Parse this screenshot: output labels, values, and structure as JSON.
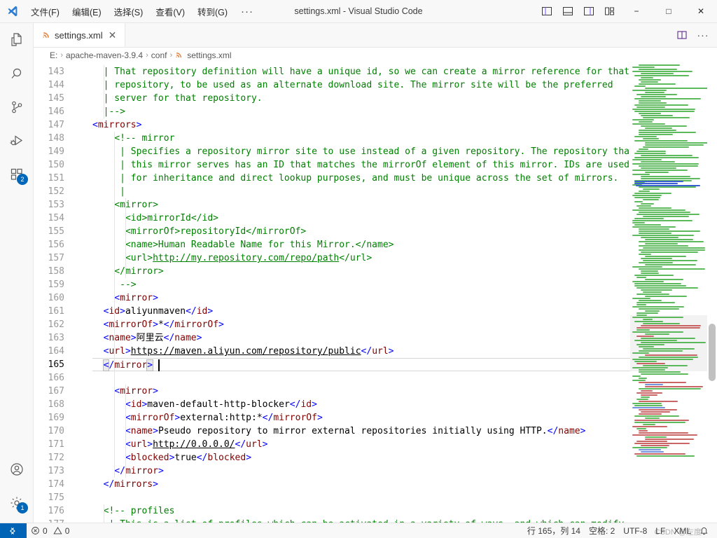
{
  "window": {
    "title": "settings.xml - Visual Studio Code",
    "logo_icon": "vscode-logo"
  },
  "menubar": {
    "items": [
      {
        "label": "文件(F)",
        "name": "menu-file"
      },
      {
        "label": "编辑(E)",
        "name": "menu-edit"
      },
      {
        "label": "选择(S)",
        "name": "menu-selection"
      },
      {
        "label": "查看(V)",
        "name": "menu-view"
      },
      {
        "label": "转到(G)",
        "name": "menu-go"
      }
    ],
    "more_label": "···"
  },
  "titlebar_controls": {
    "toggle_primary_sidebar": "layout-sidebar-left-icon",
    "toggle_panel": "layout-panel-icon",
    "toggle_secondary_sidebar": "layout-sidebar-right-icon",
    "customize_layout": "layout-customize-icon",
    "minimize": "−",
    "maximize": "□",
    "close": "✕"
  },
  "activitybar": {
    "items": [
      {
        "name": "activitybar-explorer",
        "icon": "files-icon",
        "active": false,
        "badge": ""
      },
      {
        "name": "activitybar-search",
        "icon": "search-icon",
        "active": false,
        "badge": ""
      },
      {
        "name": "activitybar-source-control",
        "icon": "source-control-icon",
        "active": false,
        "badge": ""
      },
      {
        "name": "activitybar-run-debug",
        "icon": "run-and-debug-icon",
        "active": false,
        "badge": ""
      },
      {
        "name": "activitybar-extensions",
        "icon": "extensions-icon",
        "active": false,
        "badge": "2"
      }
    ],
    "bottom_items": [
      {
        "name": "activitybar-accounts",
        "icon": "account-icon",
        "badge": ""
      },
      {
        "name": "activitybar-manage",
        "icon": "gear-icon",
        "badge": "1"
      }
    ]
  },
  "tabs": [
    {
      "label": "settings.xml",
      "icon": "xml-file-icon",
      "close": "✕",
      "active": true
    }
  ],
  "editor_actions": {
    "split_editor": "split-editor-icon",
    "more_actions": "···"
  },
  "breadcrumb": {
    "items": [
      "E:",
      "apache-maven-3.9.4",
      "conf",
      "settings.xml"
    ],
    "separator": "›",
    "file_icon": "xml-file-icon"
  },
  "editor": {
    "first_line": 143,
    "lines": [
      {
        "n": 143,
        "fold": "",
        "indent": 0,
        "tokens": [
          {
            "t": "cmt",
            "v": "  | That repository definition will have a unique id, so we can create a mirror reference for that"
          }
        ]
      },
      {
        "n": 144,
        "fold": "",
        "indent": 0,
        "tokens": [
          {
            "t": "cmt",
            "v": "  | repository, to be used as an alternate download site. The mirror site will be the preferred"
          }
        ]
      },
      {
        "n": 145,
        "fold": "",
        "indent": 0,
        "tokens": [
          {
            "t": "cmt",
            "v": "  | server for that repository."
          }
        ]
      },
      {
        "n": 146,
        "fold": "",
        "indent": 0,
        "tokens": [
          {
            "t": "cmt",
            "v": "  |-->"
          }
        ]
      },
      {
        "n": 147,
        "fold": "",
        "indent": 0,
        "tokens": [
          {
            "t": "punc",
            "v": "<"
          },
          {
            "t": "tagname",
            "v": "mirrors"
          },
          {
            "t": "punc",
            "v": ">"
          }
        ]
      },
      {
        "n": 148,
        "fold": "",
        "indent": 0,
        "tokens": [
          {
            "t": "cmt",
            "v": "    <!-- mirror"
          }
        ]
      },
      {
        "n": 149,
        "fold": "",
        "indent": 0,
        "tokens": [
          {
            "t": "cmt",
            "v": "     | Specifies a repository mirror site to use instead of a given repository. The repository that"
          }
        ]
      },
      {
        "n": 150,
        "fold": "",
        "indent": 0,
        "tokens": [
          {
            "t": "cmt",
            "v": "     | this mirror serves has an ID that matches the mirrorOf element of this mirror. IDs are used"
          }
        ]
      },
      {
        "n": 151,
        "fold": "",
        "indent": 0,
        "tokens": [
          {
            "t": "cmt",
            "v": "     | for inheritance and direct lookup purposes, and must be unique across the set of mirrors."
          }
        ]
      },
      {
        "n": 152,
        "fold": "",
        "indent": 0,
        "tokens": [
          {
            "t": "cmt",
            "v": "     |"
          }
        ]
      },
      {
        "n": 153,
        "fold": "",
        "indent": 0,
        "tokens": [
          {
            "t": "cmt",
            "v": "    <mirror>"
          }
        ]
      },
      {
        "n": 154,
        "fold": "",
        "indent": 0,
        "tokens": [
          {
            "t": "cmt",
            "v": "      <id>mirrorId</id>"
          }
        ]
      },
      {
        "n": 155,
        "fold": "",
        "indent": 0,
        "tokens": [
          {
            "t": "cmt",
            "v": "      <mirrorOf>repositoryId</mirrorOf>"
          }
        ]
      },
      {
        "n": 156,
        "fold": "",
        "indent": 0,
        "tokens": [
          {
            "t": "cmt",
            "v": "      <name>Human Readable Name for this Mirror.</name>"
          }
        ]
      },
      {
        "n": 157,
        "fold": "",
        "indent": 0,
        "tokens": [
          {
            "t": "cmt",
            "v": "      <url>"
          },
          {
            "t": "lnk",
            "v": "http://my.repository.com/repo/path"
          },
          {
            "t": "cmt",
            "v": "</url>"
          }
        ]
      },
      {
        "n": 158,
        "fold": "",
        "indent": 0,
        "tokens": [
          {
            "t": "cmt",
            "v": "    </mirror>"
          }
        ]
      },
      {
        "n": 159,
        "fold": "",
        "indent": 0,
        "tokens": [
          {
            "t": "cmt",
            "v": "     -->"
          }
        ]
      },
      {
        "n": 160,
        "fold": "",
        "indent": 0,
        "tokens": [
          {
            "t": "punc",
            "v": "    <"
          },
          {
            "t": "tagname",
            "v": "mirror"
          },
          {
            "t": "punc",
            "v": ">"
          }
        ]
      },
      {
        "n": 161,
        "fold": "",
        "indent": 0,
        "tokens": [
          {
            "t": "punc",
            "v": "  <"
          },
          {
            "t": "tagname",
            "v": "id"
          },
          {
            "t": "punc",
            "v": ">"
          },
          {
            "t": "txt",
            "v": "aliyunmaven"
          },
          {
            "t": "punc",
            "v": "</"
          },
          {
            "t": "tagname",
            "v": "id"
          },
          {
            "t": "punc",
            "v": ">"
          }
        ]
      },
      {
        "n": 162,
        "fold": "",
        "indent": 0,
        "tokens": [
          {
            "t": "punc",
            "v": "  <"
          },
          {
            "t": "tagname",
            "v": "mirrorOf"
          },
          {
            "t": "punc",
            "v": ">"
          },
          {
            "t": "txt",
            "v": "*"
          },
          {
            "t": "punc",
            "v": "</"
          },
          {
            "t": "tagname",
            "v": "mirrorOf"
          },
          {
            "t": "punc",
            "v": ">"
          }
        ]
      },
      {
        "n": 163,
        "fold": "",
        "indent": 0,
        "tokens": [
          {
            "t": "punc",
            "v": "  <"
          },
          {
            "t": "tagname",
            "v": "name"
          },
          {
            "t": "punc",
            "v": ">"
          },
          {
            "t": "txt",
            "v": "阿里云"
          },
          {
            "t": "punc",
            "v": "</"
          },
          {
            "t": "tagname",
            "v": "name"
          },
          {
            "t": "punc",
            "v": ">"
          }
        ]
      },
      {
        "n": 164,
        "fold": "",
        "indent": 0,
        "tokens": [
          {
            "t": "punc",
            "v": "  <"
          },
          {
            "t": "tagname",
            "v": "url"
          },
          {
            "t": "punc",
            "v": ">"
          },
          {
            "t": "lnk-b",
            "v": "https://maven.aliyun.com/repository/public"
          },
          {
            "t": "punc",
            "v": "</"
          },
          {
            "t": "tagname",
            "v": "url"
          },
          {
            "t": "punc",
            "v": ">"
          }
        ]
      },
      {
        "n": 165,
        "fold": "",
        "indent": 0,
        "current": true,
        "tokens": [
          {
            "t": "punc",
            "v": "  "
          },
          {
            "t": "bmatch-punc",
            "v": "<"
          },
          {
            "t": "punc",
            "v": "/"
          },
          {
            "t": "tagname",
            "v": "mirror"
          },
          {
            "t": "bmatch-punc",
            "v": ">"
          }
        ]
      },
      {
        "n": 166,
        "fold": "",
        "indent": 0,
        "tokens": []
      },
      {
        "n": 167,
        "fold": "",
        "indent": 0,
        "tokens": [
          {
            "t": "punc",
            "v": "    <"
          },
          {
            "t": "tagname",
            "v": "mirror"
          },
          {
            "t": "punc",
            "v": ">"
          }
        ]
      },
      {
        "n": 168,
        "fold": "",
        "indent": 0,
        "tokens": [
          {
            "t": "punc",
            "v": "      <"
          },
          {
            "t": "tagname",
            "v": "id"
          },
          {
            "t": "punc",
            "v": ">"
          },
          {
            "t": "txt",
            "v": "maven-default-http-blocker"
          },
          {
            "t": "punc",
            "v": "</"
          },
          {
            "t": "tagname",
            "v": "id"
          },
          {
            "t": "punc",
            "v": ">"
          }
        ]
      },
      {
        "n": 169,
        "fold": "",
        "indent": 0,
        "tokens": [
          {
            "t": "punc",
            "v": "      <"
          },
          {
            "t": "tagname",
            "v": "mirrorOf"
          },
          {
            "t": "punc",
            "v": ">"
          },
          {
            "t": "txt",
            "v": "external:http:*"
          },
          {
            "t": "punc",
            "v": "</"
          },
          {
            "t": "tagname",
            "v": "mirrorOf"
          },
          {
            "t": "punc",
            "v": ">"
          }
        ]
      },
      {
        "n": 170,
        "fold": "",
        "indent": 0,
        "tokens": [
          {
            "t": "punc",
            "v": "      <"
          },
          {
            "t": "tagname",
            "v": "name"
          },
          {
            "t": "punc",
            "v": ">"
          },
          {
            "t": "txt",
            "v": "Pseudo repository to mirror external repositories initially using HTTP."
          },
          {
            "t": "punc",
            "v": "</"
          },
          {
            "t": "tagname",
            "v": "name"
          },
          {
            "t": "punc",
            "v": ">"
          }
        ]
      },
      {
        "n": 171,
        "fold": "",
        "indent": 0,
        "tokens": [
          {
            "t": "punc",
            "v": "      <"
          },
          {
            "t": "tagname",
            "v": "url"
          },
          {
            "t": "punc",
            "v": ">"
          },
          {
            "t": "lnk-b",
            "v": "http://0.0.0.0/"
          },
          {
            "t": "punc",
            "v": "</"
          },
          {
            "t": "tagname",
            "v": "url"
          },
          {
            "t": "punc",
            "v": ">"
          }
        ]
      },
      {
        "n": 172,
        "fold": "",
        "indent": 0,
        "tokens": [
          {
            "t": "punc",
            "v": "      <"
          },
          {
            "t": "tagname",
            "v": "blocked"
          },
          {
            "t": "punc",
            "v": ">"
          },
          {
            "t": "txt",
            "v": "true"
          },
          {
            "t": "punc",
            "v": "</"
          },
          {
            "t": "tagname",
            "v": "blocked"
          },
          {
            "t": "punc",
            "v": ">"
          }
        ]
      },
      {
        "n": 173,
        "fold": "",
        "indent": 0,
        "tokens": [
          {
            "t": "punc",
            "v": "    </"
          },
          {
            "t": "tagname",
            "v": "mirror"
          },
          {
            "t": "punc",
            "v": ">"
          }
        ]
      },
      {
        "n": 174,
        "fold": "",
        "indent": 0,
        "tokens": [
          {
            "t": "punc",
            "v": "  </"
          },
          {
            "t": "tagname",
            "v": "mirrors"
          },
          {
            "t": "punc",
            "v": ">"
          }
        ]
      },
      {
        "n": 175,
        "fold": "",
        "indent": 0,
        "tokens": []
      },
      {
        "n": 176,
        "fold": "",
        "indent": 0,
        "tokens": [
          {
            "t": "cmt",
            "v": "  <!-- profiles"
          }
        ]
      },
      {
        "n": 177,
        "fold": "",
        "indent": 0,
        "tokens": [
          {
            "t": "cmt",
            "v": "   | This is a list of profiles which can be activated in a variety of ways, and which can modify"
          }
        ]
      }
    ]
  },
  "statusbar": {
    "remote_label": "",
    "remote_icon": "remote-indicator-icon",
    "problems": {
      "errors_icon": "error-icon",
      "errors": "0",
      "warnings_icon": "warning-icon",
      "warnings": "0"
    },
    "cursor_position": "行 165，列 14",
    "indentation": "空格: 2",
    "encoding": "UTF-8",
    "eol": "LF",
    "language": "XML",
    "notifications_icon": "bell-icon",
    "watermark": "CSDN @左度"
  }
}
